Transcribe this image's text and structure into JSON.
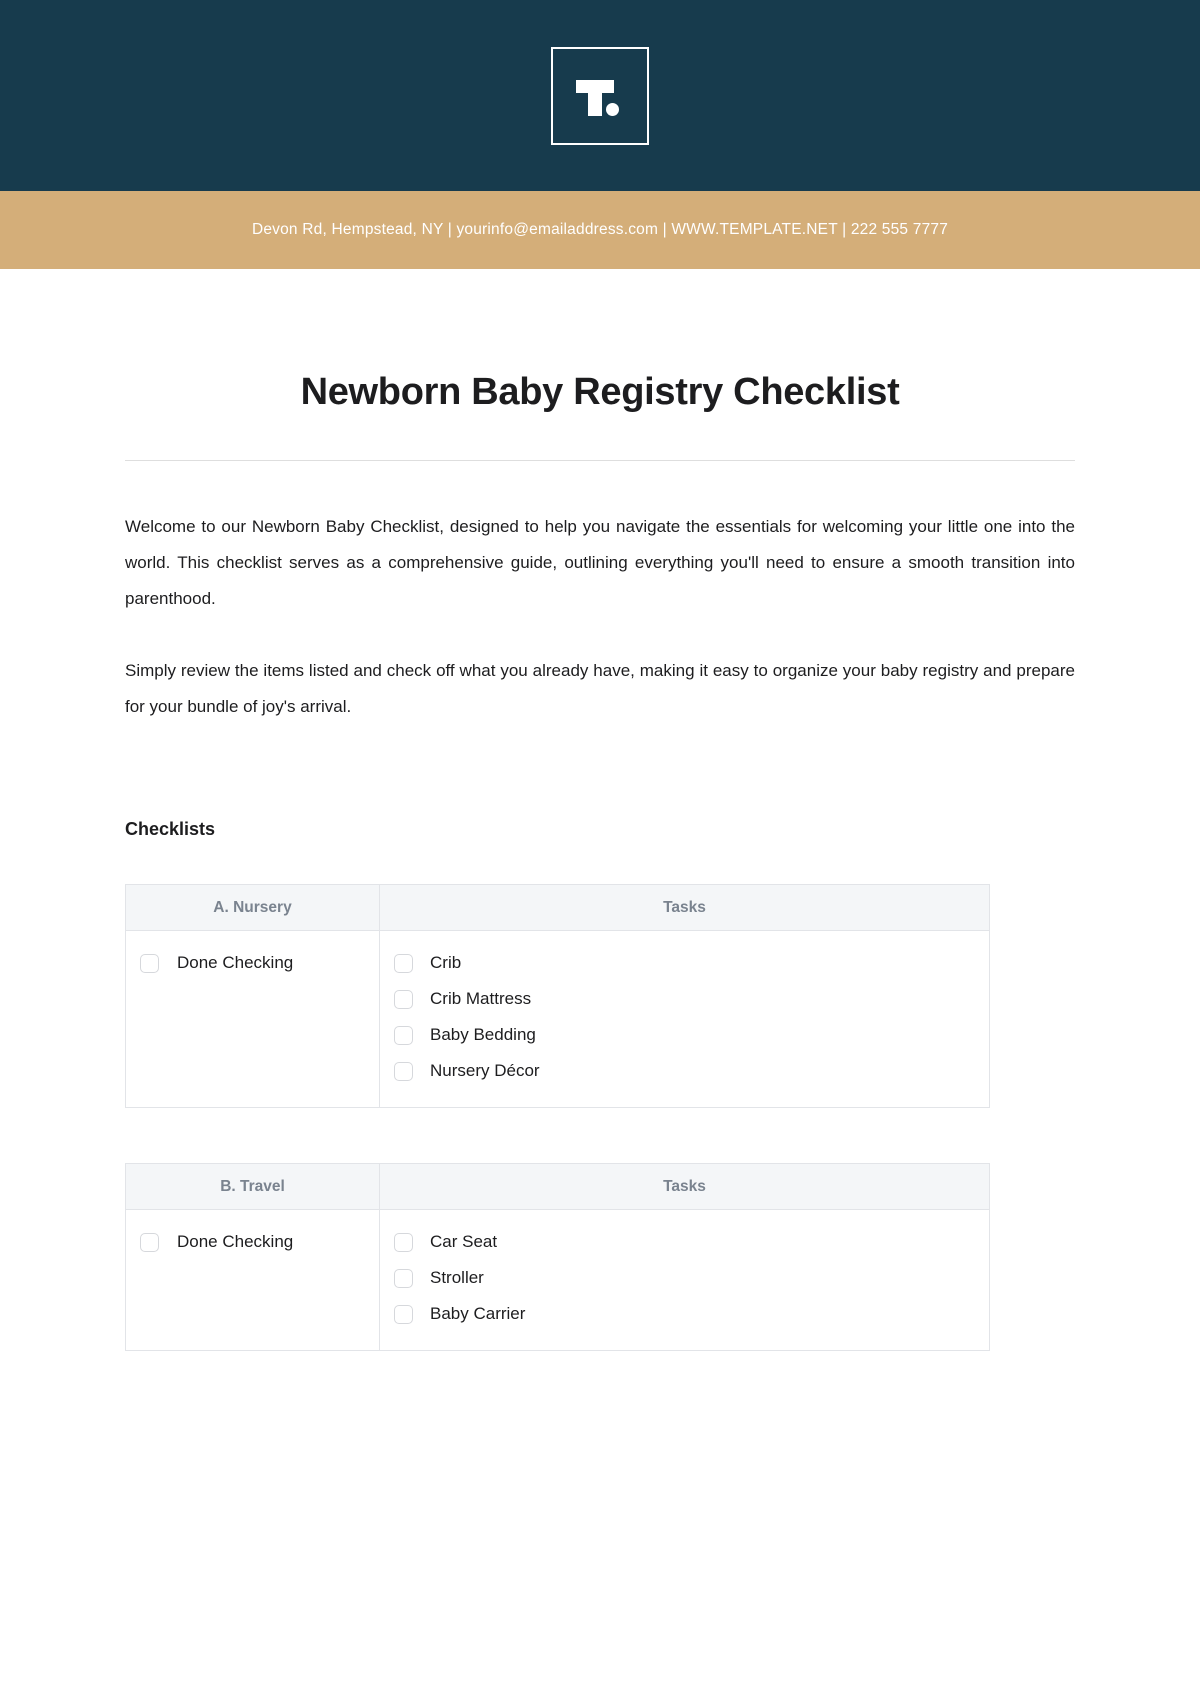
{
  "brand": {
    "logo_letter": "T",
    "logo_icon": "template-net-logo",
    "header_bg": "#173B4D",
    "contact_bg": "#D4AE79"
  },
  "contact": {
    "line": "Devon Rd, Hempstead, NY | yourinfo@emailaddress.com | WWW.TEMPLATE.NET | 222 555 7777"
  },
  "document": {
    "title": "Newborn Baby Registry Checklist",
    "paragraphs": [
      "Welcome to our Newborn Baby Checklist, designed to help you navigate the essentials for welcoming your little one into the world. This checklist serves as a comprehensive guide, outlining everything you'll need to ensure a smooth transition into parenthood.",
      "Simply review the items listed and check off what you already have, making it easy to organize your baby registry and prepare for your bundle of joy's arrival."
    ],
    "section_heading": "Checklists"
  },
  "tables": [
    {
      "category_header": "A. Nursery",
      "tasks_header": "Tasks",
      "done_label": "Done Checking",
      "tasks": [
        "Crib",
        "Crib Mattress",
        "Baby Bedding",
        "Nursery Décor"
      ]
    },
    {
      "category_header": "B. Travel",
      "tasks_header": "Tasks",
      "done_label": "Done Checking",
      "tasks": [
        "Car Seat",
        "Stroller",
        "Baby Carrier"
      ]
    }
  ]
}
